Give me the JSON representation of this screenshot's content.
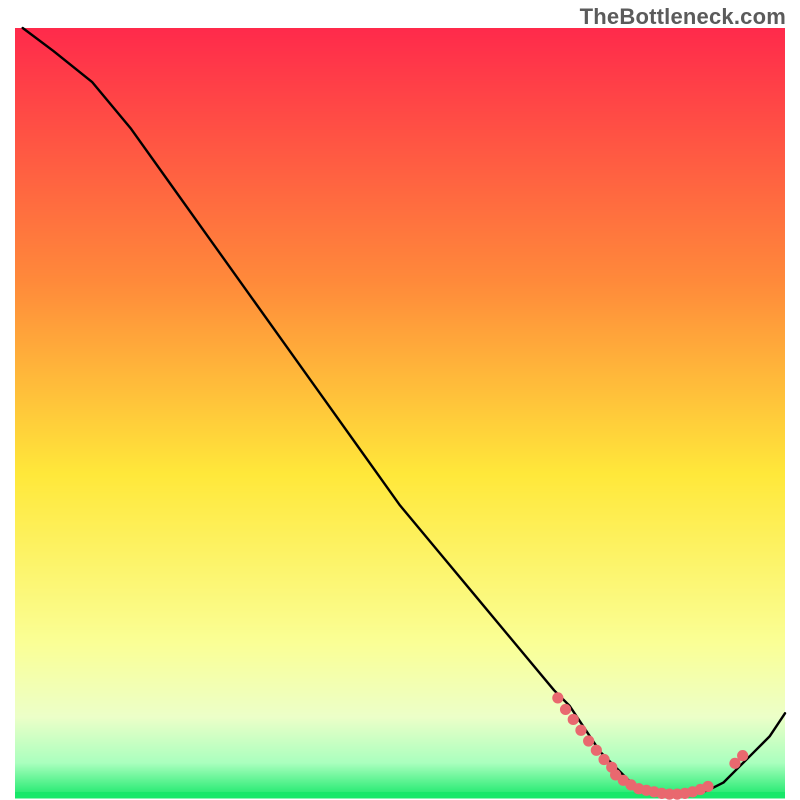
{
  "watermark": "TheBottleneck.com",
  "chart_data": {
    "type": "line",
    "title": "",
    "xlabel": "",
    "ylabel": "",
    "xlim": [
      0,
      100
    ],
    "ylim": [
      0,
      100
    ],
    "grid": false,
    "legend": "none",
    "background_gradient": {
      "top_color": "#ff2a4b",
      "mid_top_color": "#ff8a3a",
      "mid_color": "#ffe83a",
      "mid_low_color": "#f8ff8a",
      "low_color": "#d8ffb0",
      "bottom_color": "#17e86a"
    },
    "series": [
      {
        "name": "bottleneck-curve",
        "stroke": "#000000",
        "x": [
          1,
          5,
          10,
          15,
          20,
          25,
          30,
          35,
          40,
          45,
          50,
          55,
          60,
          65,
          70,
          72,
          74,
          76,
          78,
          80,
          82,
          84,
          86,
          88,
          90,
          92,
          94,
          96,
          98,
          100
        ],
        "y": [
          100,
          97,
          93,
          87,
          80,
          73,
          66,
          59,
          52,
          45,
          38,
          32,
          26,
          20,
          14,
          12,
          9,
          6,
          4,
          2,
          1,
          0.5,
          0.3,
          0.5,
          1,
          2,
          4,
          6,
          8,
          11
        ]
      }
    ],
    "dotted_segments": [
      {
        "name": "highlight-left",
        "color": "#e9686f",
        "x": [
          70.5,
          71.5,
          72.5,
          73.5,
          74.5,
          75.5,
          76.5,
          77.5
        ],
        "y": [
          13,
          11.5,
          10.2,
          8.8,
          7.4,
          6.2,
          5.0,
          4.0
        ]
      },
      {
        "name": "highlight-flat",
        "color": "#e9686f",
        "x": [
          78,
          79,
          80,
          81,
          82,
          83,
          84,
          85,
          86,
          87,
          88,
          89,
          90
        ],
        "y": [
          3.0,
          2.3,
          1.7,
          1.2,
          1.0,
          0.8,
          0.6,
          0.5,
          0.5,
          0.6,
          0.8,
          1.1,
          1.5
        ]
      },
      {
        "name": "highlight-right",
        "color": "#e9686f",
        "x": [
          93.5,
          94.5
        ],
        "y": [
          4.5,
          5.5
        ]
      }
    ]
  }
}
